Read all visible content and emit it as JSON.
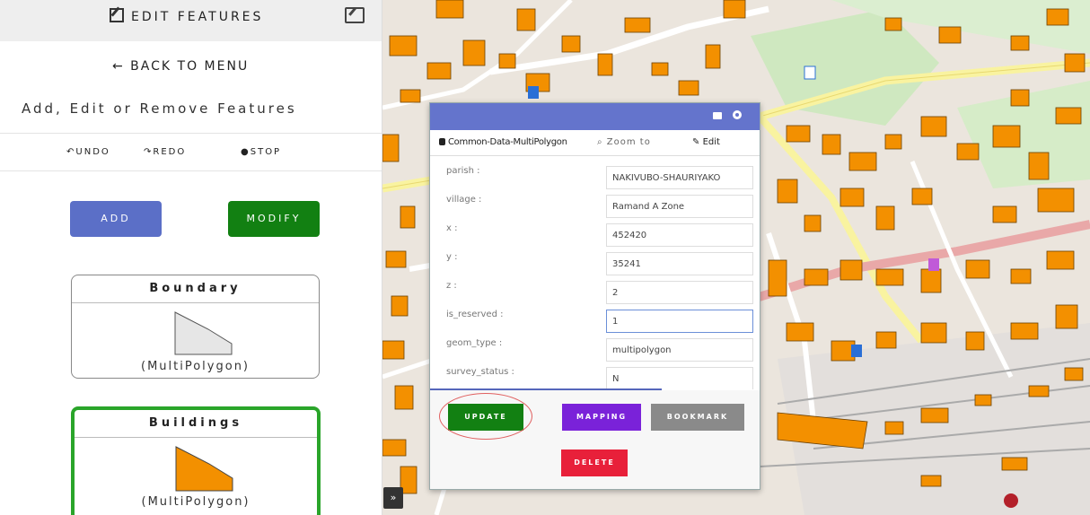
{
  "sidebar": {
    "title": "EDIT FEATURES",
    "back": "← BACK TO MENU",
    "subtitle": "Add, Edit or Remove Features",
    "tools": {
      "undo": "UNDO",
      "redo": "REDO",
      "stop": "STOP"
    },
    "add_label": "ADD",
    "modify_label": "MODIFY",
    "layers": [
      {
        "name": "Boundary",
        "type": "(MultiPolygon)"
      },
      {
        "name": "Buildings",
        "type": "(MultiPolygon)"
      }
    ]
  },
  "popup": {
    "layer": "Common-Data-MultiPolygon",
    "zoom": "Zoom to",
    "edit": "Edit",
    "rows": [
      {
        "label": "parish :",
        "value": "NAKIVUBO-SHAURIYAKO"
      },
      {
        "label": "village :",
        "value": "Ramand A Zone"
      },
      {
        "label": "x :",
        "value": "452420"
      },
      {
        "label": "y :",
        "value": "35241"
      },
      {
        "label": "z :",
        "value": "2"
      },
      {
        "label": "is_reserved :",
        "value": "1"
      },
      {
        "label": "geom_type :",
        "value": "multipolygon"
      },
      {
        "label": "survey_status :",
        "value": "N"
      }
    ],
    "buttons": {
      "update": "UPDATE",
      "mapping": "MAPPING",
      "bookmark": "BOOKMARK",
      "delete": "DELETE"
    }
  },
  "colors": {
    "accent": "#6474cc",
    "modify": "#128012",
    "mapping": "#7a22d9",
    "delete": "#e8203a",
    "building": "#f39000"
  }
}
